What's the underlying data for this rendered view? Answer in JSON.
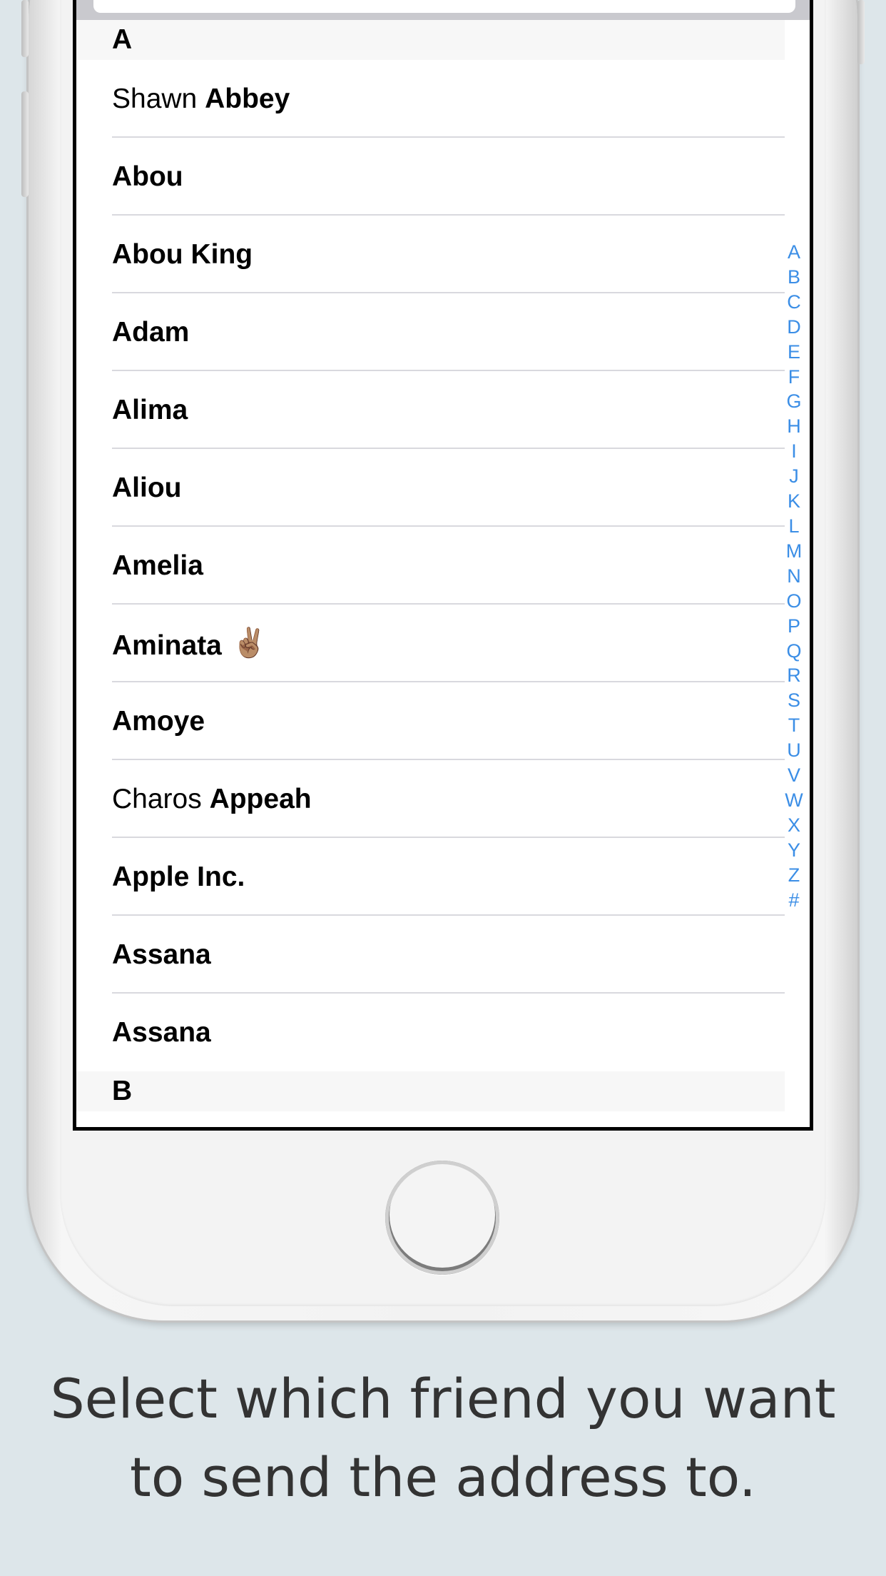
{
  "contacts": {
    "sections": [
      {
        "letter": "A",
        "rows": [
          {
            "first": "Shawn ",
            "last": "Abbey",
            "emoji": ""
          },
          {
            "first": "",
            "last": "Abou",
            "emoji": ""
          },
          {
            "first": "",
            "last": "Abou King",
            "emoji": ""
          },
          {
            "first": "",
            "last": "Adam",
            "emoji": ""
          },
          {
            "first": "",
            "last": "Alima",
            "emoji": ""
          },
          {
            "first": "",
            "last": "Aliou",
            "emoji": ""
          },
          {
            "first": "",
            "last": "Amelia",
            "emoji": ""
          },
          {
            "first": "",
            "last": "Aminata",
            "emoji": "✌🏽"
          },
          {
            "first": "",
            "last": "Amoye",
            "emoji": ""
          },
          {
            "first": "Charos ",
            "last": "Appeah",
            "emoji": ""
          },
          {
            "first": "",
            "last": "Apple Inc.",
            "emoji": ""
          },
          {
            "first": "",
            "last": "Assana",
            "emoji": ""
          },
          {
            "first": "",
            "last": "Assana",
            "emoji": ""
          }
        ]
      },
      {
        "letter": "B",
        "rows": []
      }
    ],
    "index": [
      "A",
      "B",
      "C",
      "D",
      "E",
      "F",
      "G",
      "H",
      "I",
      "J",
      "K",
      "L",
      "M",
      "N",
      "O",
      "P",
      "Q",
      "R",
      "S",
      "T",
      "U",
      "V",
      "W",
      "X",
      "Y",
      "Z",
      "#"
    ]
  },
  "caption": {
    "line1": "Select which friend you want",
    "line2": "to send the address to."
  },
  "colors": {
    "background": "#dde6ea",
    "index_accent": "#3b8ee6"
  }
}
